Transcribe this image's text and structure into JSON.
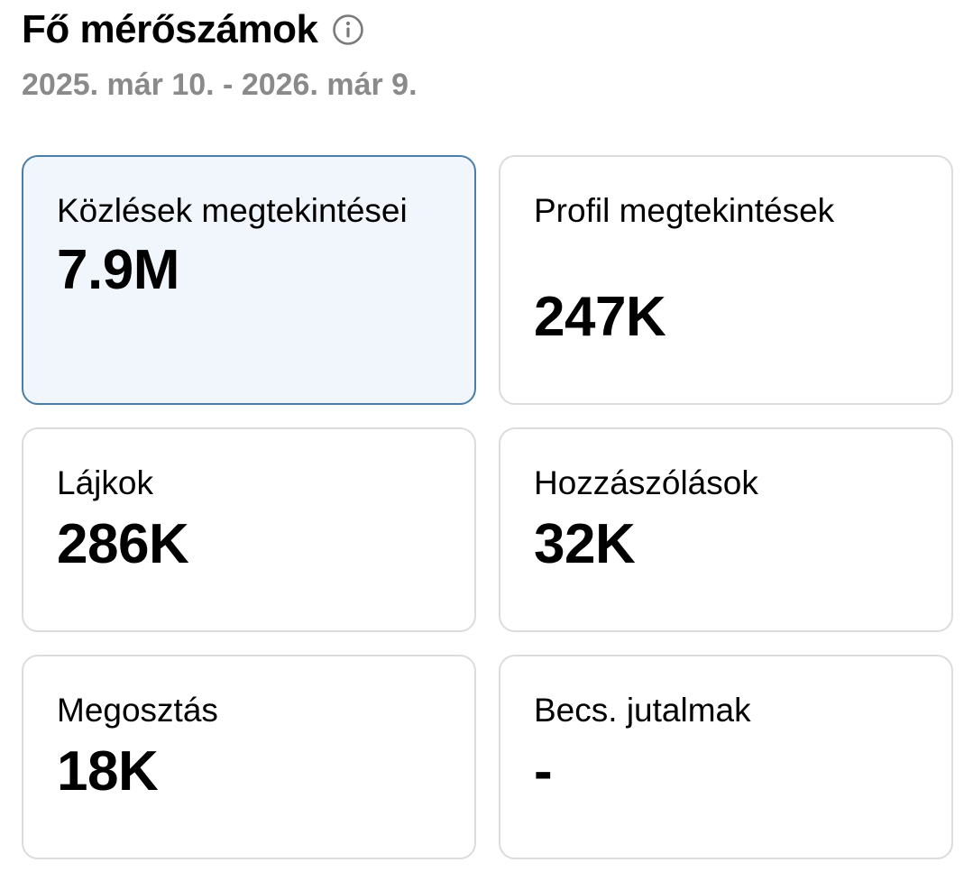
{
  "header": {
    "title": "Fő mérőszámok",
    "info_icon": "info-circle-icon",
    "date_range": "2025. már 10. - 2026. már 9."
  },
  "colors": {
    "selected_card_bg": "#f1f6fd",
    "selected_card_border": "#4a7ea8",
    "card_border": "#dcdcdc",
    "subtitle": "#8a8a8a"
  },
  "metrics": [
    {
      "label": "Közlések megtekintései",
      "value": "7.9M",
      "selected": true
    },
    {
      "label": "Profil megtekintések",
      "value": "247K",
      "selected": false
    },
    {
      "label": "Lájkok",
      "value": "286K",
      "selected": false
    },
    {
      "label": "Hozzászólások",
      "value": "32K",
      "selected": false
    },
    {
      "label": "Megosztás",
      "value": "18K",
      "selected": false
    },
    {
      "label": "Becs. jutalmak",
      "value": "-",
      "selected": false
    }
  ]
}
